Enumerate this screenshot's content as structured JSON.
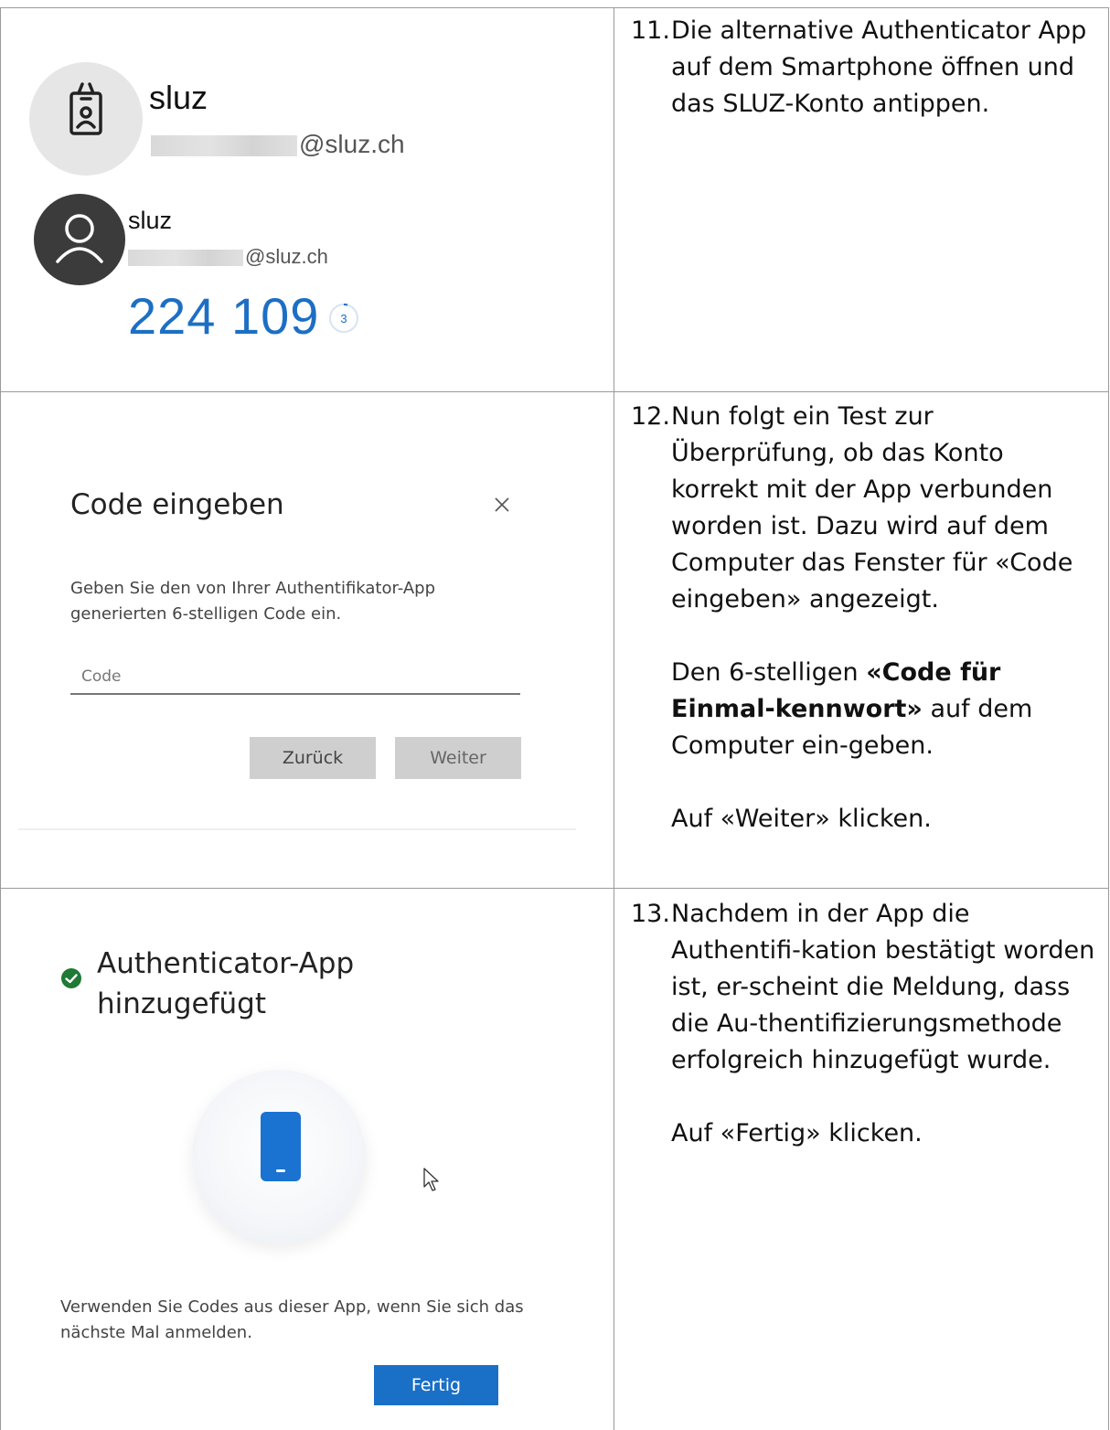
{
  "steps": [
    {
      "number": "11.",
      "text": "Die alternative Authenticator App auf dem Smartphone öffnen und das SLUZ-Konto antippen."
    },
    {
      "number": "12.",
      "text1": "Nun folgt ein Test zur Überprüfung, ob das Konto korrekt mit der App verbunden worden ist. Dazu wird auf dem Computer das Fenster für «Code eingeben» angezeigt.",
      "text2_pre": "Den 6-stelligen ",
      "text2_bold": "«Code für Einmal-kennwort»",
      "text2_post": " auf dem Computer ein-geben.",
      "text3": "Auf «Weiter» klicken."
    },
    {
      "number": "13.",
      "text1": "Nachdem in der App die Authentifi-kation bestätigt worden ist, er-scheint die Meldung, dass die Au-thentifizierungsmethode erfolgreich hinzugefügt wurde.",
      "text2": "Auf «Fertig» klicken."
    }
  ],
  "app": {
    "account1": {
      "name": "sluz",
      "email_suffix": "@sluz.ch"
    },
    "account2": {
      "name": "sluz",
      "email_suffix": "@sluz.ch"
    },
    "otp_code": "224 109",
    "timer": "3"
  },
  "dialog": {
    "title": "Code eingeben",
    "close_symbol": "×",
    "description": "Geben Sie den von Ihrer Authentifikator-App generierten 6-stelligen Code ein.",
    "code_placeholder": "Code",
    "back_label": "Zurück",
    "next_label": "Weiter"
  },
  "success": {
    "title_line1": "Authenticator-App",
    "title_line2": "hinzugefügt",
    "description": "Verwenden Sie Codes aus dieser App, wenn Sie sich das nächste Mal anmelden.",
    "done_label": "Fertig"
  },
  "colors": {
    "otp_blue": "#1d6fc4",
    "button_blue": "#1a6fc6",
    "success_green": "#1e7a34"
  }
}
